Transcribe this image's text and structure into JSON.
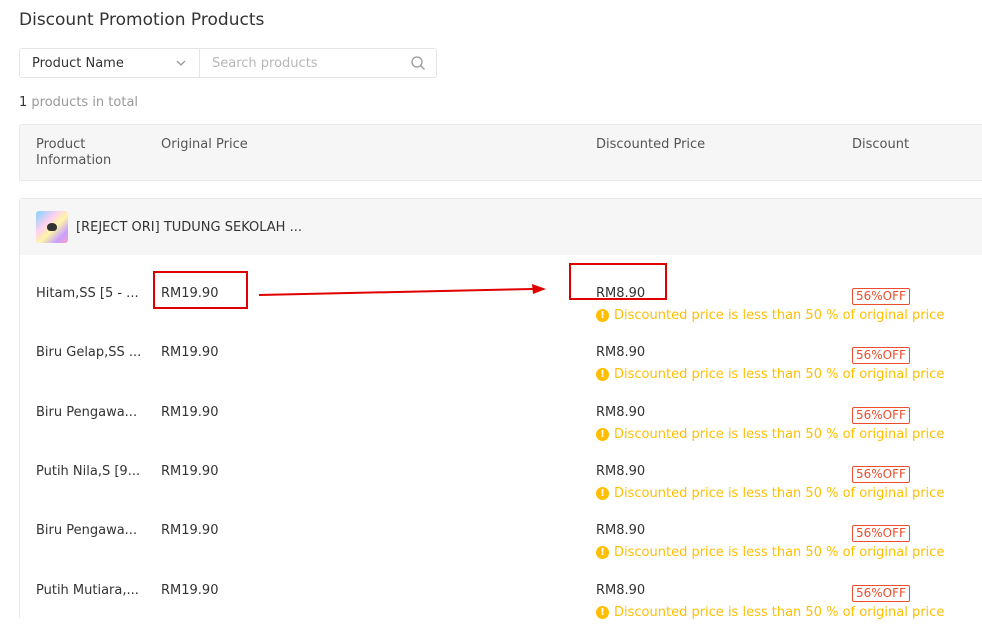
{
  "page": {
    "title": "Discount Promotion Products"
  },
  "filter": {
    "field": "Product Name",
    "search_placeholder": "Search products"
  },
  "summary": {
    "count": "1",
    "text": " products in total"
  },
  "table": {
    "headers": {
      "product": "Product Information",
      "original": "Original Price",
      "discounted": "Discounted Price",
      "discount": "Discount"
    },
    "product_name": "[REJECT ORI] TUDUNG SEKOLAH ...",
    "rows": [
      {
        "variant": "Hitam,SS [5 - ...",
        "original": "RM19.90",
        "discounted": "RM8.90",
        "warning": "Discounted price is less than 50 % of original price",
        "badge": "56%OFF"
      },
      {
        "variant": "Biru Gelap,SS ...",
        "original": "RM19.90",
        "discounted": "RM8.90",
        "warning": "Discounted price is less than 50 % of original price",
        "badge": "56%OFF"
      },
      {
        "variant": "Biru Pengawa...",
        "original": "RM19.90",
        "discounted": "RM8.90",
        "warning": "Discounted price is less than 50 % of original price",
        "badge": "56%OFF"
      },
      {
        "variant": "Putih Nila,S [9...",
        "original": "RM19.90",
        "discounted": "RM8.90",
        "warning": "Discounted price is less than 50 % of original price",
        "badge": "56%OFF"
      },
      {
        "variant": "Biru Pengawa...",
        "original": "RM19.90",
        "discounted": "RM8.90",
        "warning": "Discounted price is less than 50 % of original price",
        "badge": "56%OFF"
      },
      {
        "variant": "Putih Mutiara,...",
        "original": "RM19.90",
        "discounted": "RM8.90",
        "warning": "Discounted price is less than 50 % of original price",
        "badge": "56%OFF"
      }
    ]
  },
  "colors": {
    "accent": "#ee4d2d",
    "warning": "#ffbf00",
    "annotation": "#e00000"
  },
  "icons": {
    "dropdown": "chevron-down-icon",
    "search": "search-icon",
    "warning": "warning-icon",
    "thumbnail": "product-thumbnail"
  }
}
